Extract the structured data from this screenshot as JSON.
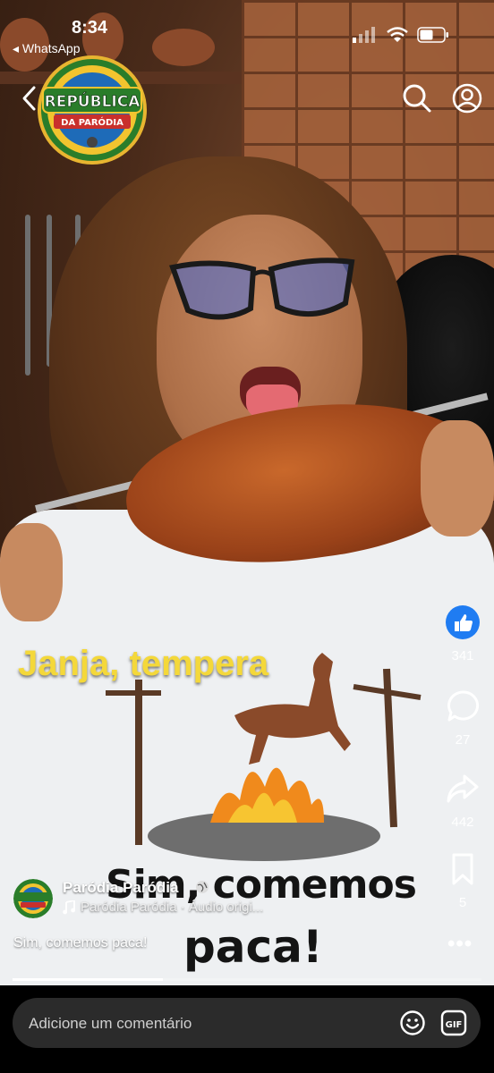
{
  "status_bar": {
    "time": "8:34",
    "back_app": "◂ WhatsApp"
  },
  "header": {
    "logo_text_top": "REPÚBLICA",
    "logo_text_bottom": "DA PARÓDIA"
  },
  "video": {
    "overlay_caption": "Janja, tempera",
    "shirt_text_line1": "Sim, comemos",
    "shirt_text_line2": "paca!",
    "progress_fraction": 0.32
  },
  "actions": {
    "likes": "341",
    "comments": "27",
    "shares": "442",
    "saves": "5"
  },
  "post": {
    "author": "Paródia Paródia",
    "audio": "Paródia Paródia · Áudio origi...",
    "caption": "Sim, comemos paca!"
  },
  "comment_bar": {
    "placeholder": "Adicione um comentário"
  },
  "colors": {
    "like_blue": "#1f7cf2",
    "caption_yellow": "#f4d83a",
    "comment_bg": "#2b2b2b"
  },
  "icons": [
    "back-icon",
    "search-icon",
    "profile-icon",
    "like-icon",
    "comment-icon",
    "share-icon",
    "bookmark-icon",
    "more-icon",
    "music-note-icon",
    "globe-icon",
    "emoji-icon",
    "gif-icon"
  ]
}
